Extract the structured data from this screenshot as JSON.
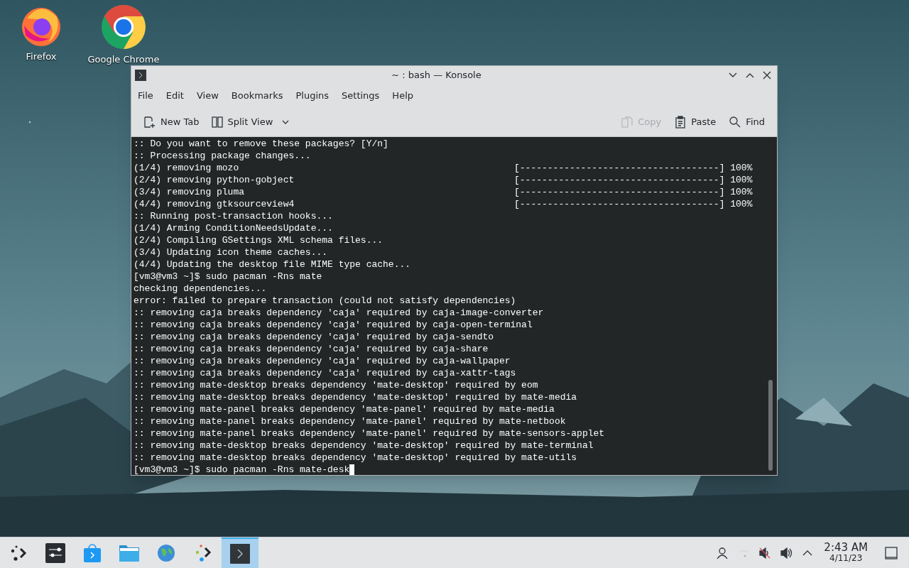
{
  "desktop_icons": [
    {
      "kind": "firefox",
      "label": "Firefox"
    },
    {
      "kind": "chrome",
      "label": "Google Chrome"
    }
  ],
  "window": {
    "title": "~ : bash — Konsole",
    "buttons": [
      {
        "kind": "minimize"
      },
      {
        "kind": "maximize"
      },
      {
        "kind": "close"
      }
    ]
  },
  "menu": [
    "File",
    "Edit",
    "View",
    "Bookmarks",
    "Plugins",
    "Settings",
    "Help"
  ],
  "toolbar": {
    "left": [
      {
        "kind": "new-tab",
        "label": "New Tab",
        "disabled": false
      },
      {
        "kind": "split-view",
        "label": "Split View",
        "disabled": false
      }
    ],
    "right": [
      {
        "kind": "copy",
        "label": "Copy",
        "disabled": true
      },
      {
        "kind": "paste",
        "label": "Paste",
        "disabled": false
      },
      {
        "kind": "find",
        "label": "Find",
        "disabled": false
      }
    ]
  },
  "terminal": {
    "lines": [
      {
        "text": ":: Do you want to remove these packages? [Y/n]"
      },
      {
        "text": ":: Processing package changes..."
      },
      {
        "text": "(1/4) removing mozo",
        "progress": "[------------------------------------] 100%"
      },
      {
        "text": "(2/4) removing python-gobject",
        "progress": "[------------------------------------] 100%"
      },
      {
        "text": "(3/4) removing pluma",
        "progress": "[------------------------------------] 100%"
      },
      {
        "text": "(4/4) removing gtksourceview4",
        "progress": "[------------------------------------] 100%"
      },
      {
        "text": ":: Running post-transaction hooks..."
      },
      {
        "text": "(1/4) Arming ConditionNeedsUpdate..."
      },
      {
        "text": "(2/4) Compiling GSettings XML schema files..."
      },
      {
        "text": "(3/4) Updating icon theme caches..."
      },
      {
        "text": "(4/4) Updating the desktop file MIME type cache..."
      },
      {
        "text": "[vm3@vm3 ~]$ sudo pacman -Rns mate"
      },
      {
        "text": "checking dependencies..."
      },
      {
        "text": "error: failed to prepare transaction (could not satisfy dependencies)"
      },
      {
        "text": ":: removing caja breaks dependency 'caja' required by caja-image-converter"
      },
      {
        "text": ":: removing caja breaks dependency 'caja' required by caja-open-terminal"
      },
      {
        "text": ":: removing caja breaks dependency 'caja' required by caja-sendto"
      },
      {
        "text": ":: removing caja breaks dependency 'caja' required by caja-share"
      },
      {
        "text": ":: removing caja breaks dependency 'caja' required by caja-wallpaper"
      },
      {
        "text": ":: removing caja breaks dependency 'caja' required by caja-xattr-tags"
      },
      {
        "text": ":: removing mate-desktop breaks dependency 'mate-desktop' required by eom"
      },
      {
        "text": ":: removing mate-desktop breaks dependency 'mate-desktop' required by mate-media"
      },
      {
        "text": ":: removing mate-panel breaks dependency 'mate-panel' required by mate-media"
      },
      {
        "text": ":: removing mate-panel breaks dependency 'mate-panel' required by mate-netbook"
      },
      {
        "text": ":: removing mate-panel breaks dependency 'mate-panel' required by mate-sensors-applet"
      },
      {
        "text": ":: removing mate-desktop breaks dependency 'mate-desktop' required by mate-terminal"
      },
      {
        "text": ":: removing mate-desktop breaks dependency 'mate-desktop' required by mate-utils"
      }
    ],
    "prompt": "[vm3@vm3 ~]$ sudo pacman -Rns mate-desk"
  },
  "taskbar": {
    "items": [
      {
        "kind": "launcher",
        "selected": false
      },
      {
        "kind": "settings",
        "selected": false
      },
      {
        "kind": "store",
        "selected": false
      },
      {
        "kind": "files",
        "selected": false
      },
      {
        "kind": "globe",
        "selected": false
      },
      {
        "kind": "dots",
        "selected": false
      },
      {
        "kind": "konsole",
        "selected": true
      }
    ],
    "tray": [
      {
        "kind": "user"
      },
      {
        "kind": "network"
      },
      {
        "kind": "mic-muted"
      },
      {
        "kind": "volume"
      },
      {
        "kind": "expand"
      }
    ],
    "time": "2:43 AM",
    "date": "4/11/23"
  }
}
